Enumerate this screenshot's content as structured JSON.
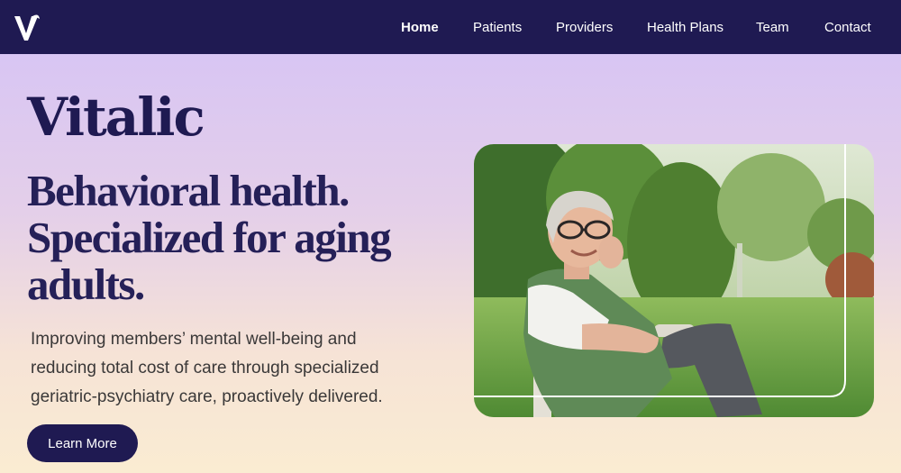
{
  "nav": {
    "logo_alt": "V",
    "items": [
      {
        "label": "Home",
        "active": true
      },
      {
        "label": "Patients",
        "active": false
      },
      {
        "label": "Providers",
        "active": false
      },
      {
        "label": "Health Plans",
        "active": false
      },
      {
        "label": "Team",
        "active": false
      },
      {
        "label": "Contact",
        "active": false
      }
    ]
  },
  "hero": {
    "brand": "Vitalic",
    "headline_lines": [
      "Behavioral health.",
      "Specialized for aging",
      "adults."
    ],
    "description_lines": [
      "Improving members’ mental well-being and",
      "reducing total cost of care through specialized",
      "geriatric-psychiatry care, proactively delivered."
    ],
    "cta_label": "Learn More",
    "image_alt": "Smiling older woman with glasses seated in a chair in a garden"
  },
  "colors": {
    "navy": "#1f1a52",
    "headline": "#252058",
    "body_text": "#3a3838",
    "gradient_top": "#d4c2f7",
    "gradient_bottom": "#faecd2"
  }
}
